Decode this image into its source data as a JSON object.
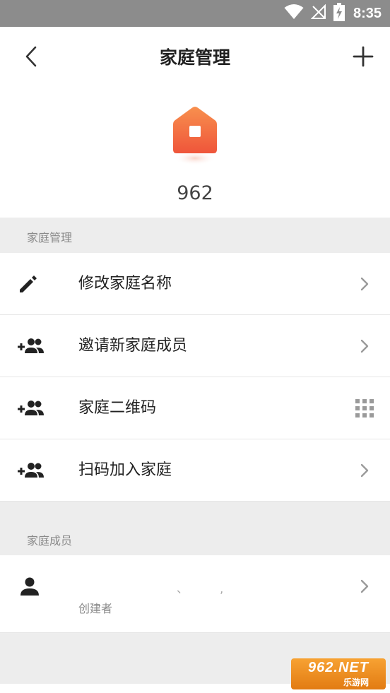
{
  "status_bar": {
    "time": "8:35",
    "icons": [
      "wifi-icon",
      "no-signal-icon",
      "battery-charging-icon"
    ]
  },
  "header": {
    "title": "家庭管理",
    "back_icon": "chevron-left-icon",
    "add_icon": "plus-icon"
  },
  "home": {
    "icon": "home-icon",
    "name": "962",
    "colors": {
      "icon_top": "#f88850",
      "icon_bottom": "#f05a3a"
    }
  },
  "section_manage": {
    "label": "家庭管理",
    "items": [
      {
        "label": "修改家庭名称",
        "icon": "edit-icon",
        "right_icon": "chevron-right-icon"
      },
      {
        "label": "邀请新家庭成员",
        "icon": "add-member-icon",
        "right_icon": "chevron-right-icon"
      },
      {
        "label": "家庭二维码",
        "icon": "add-member-icon",
        "right_icon": "qr-grid-icon"
      },
      {
        "label": "扫码加入家庭",
        "icon": "add-member-icon",
        "right_icon": "chevron-right-icon"
      }
    ]
  },
  "section_members": {
    "label": "家庭成员",
    "members": [
      {
        "name": "、 ,",
        "role": "创建者",
        "icon": "person-icon"
      }
    ]
  },
  "watermark": {
    "top": "962.NET",
    "bottom": "乐游网"
  }
}
